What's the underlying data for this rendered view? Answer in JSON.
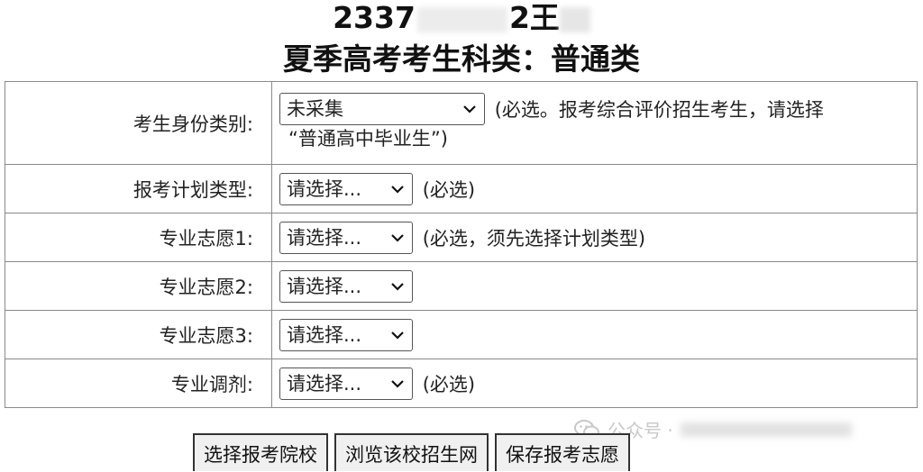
{
  "header": {
    "student_id_prefix": "2337",
    "student_id_suffix": "2",
    "name_visible": "王",
    "subtitle": "夏季高考考生科类：普通类"
  },
  "form": {
    "rows": [
      {
        "label": "考生身份类别:",
        "selected": "未采集",
        "note": "(必选。报考综合评价招生考生，请选择",
        "note2": "“普通高中毕业生”)"
      },
      {
        "label": "报考计划类型:",
        "selected": "请选择...",
        "note": "(必选)"
      },
      {
        "label": "专业志愿1:",
        "selected": "请选择...",
        "note": "(必选，须先选择计划类型)"
      },
      {
        "label": "专业志愿2:",
        "selected": "请选择..."
      },
      {
        "label": "专业志愿3:",
        "selected": "请选择..."
      },
      {
        "label": "专业调剂:",
        "selected": "请选择...",
        "note": "(必选)"
      }
    ]
  },
  "buttons": {
    "choose_school": "选择报考院校",
    "browse_site": "浏览该校招生网",
    "save_choice": "保存报考志愿"
  },
  "watermark": {
    "text": "公众号 ·"
  },
  "icons": {
    "select": "chevron-down-icon",
    "watermark": "wechat-icon"
  }
}
